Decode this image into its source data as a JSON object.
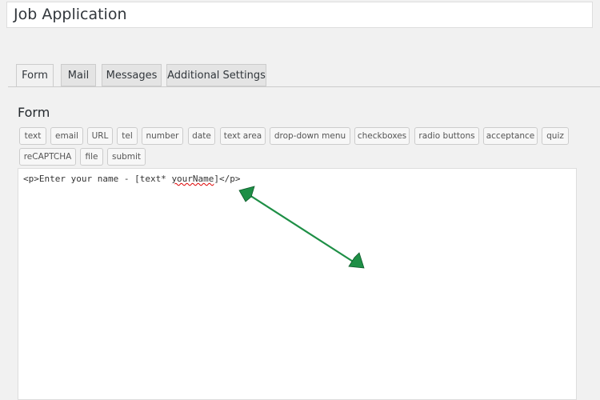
{
  "page": {
    "title_value": "Job Application"
  },
  "tabs": [
    {
      "label": "Form",
      "active": true
    },
    {
      "label": "Mail"
    },
    {
      "label": "Messages"
    },
    {
      "label": "Additional Settings"
    }
  ],
  "panel": {
    "heading": "Form",
    "tag_buttons": [
      "text",
      "email",
      "URL",
      "tel",
      "number",
      "date",
      "text area",
      "drop-down menu",
      "checkboxes",
      "radio buttons",
      "acceptance",
      "quiz",
      "reCAPTCHA",
      "file",
      "submit"
    ]
  },
  "editor": {
    "code_prefix": "<p>Enter your name - [text* ",
    "code_spell": "yourName",
    "code_suffix": "]</p>"
  },
  "annotation": {
    "color": "#1e8f46",
    "icon": "double-headed-arrow"
  }
}
